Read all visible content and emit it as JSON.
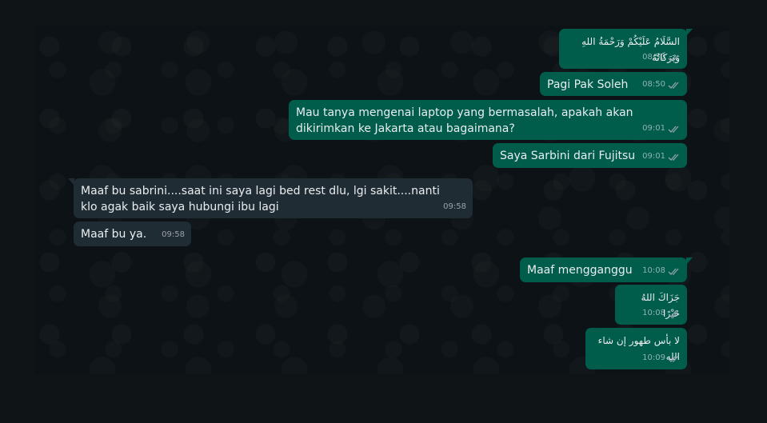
{
  "messages": [
    {
      "dir": "out",
      "text": "السَّلَامُ عَلَيْكُمْ وَرَحْمَةُ اللهِ وَبَرَكَاتُهُ",
      "time": "08:50",
      "ticks": "double-check-icon"
    },
    {
      "dir": "out",
      "text": "Pagi Pak Soleh",
      "time": "08:50",
      "ticks": "double-check-icon"
    },
    {
      "dir": "out",
      "text": "Mau tanya mengenai laptop yang bermasalah, apakah akan dikirimkan ke Jakarta atau bagaimana?",
      "time": "09:01",
      "ticks": "double-check-icon"
    },
    {
      "dir": "out",
      "text": "Saya Sarbini dari Fujitsu",
      "time": "09:01",
      "ticks": "double-check-icon"
    },
    {
      "dir": "in",
      "text": "Maaf bu sabrini....saat ini saya lagi bed rest dlu, lgi sakit....nanti klo agak baik saya hubungi ibu lagi",
      "time": "09:58"
    },
    {
      "dir": "in",
      "text": "Maaf bu ya.",
      "time": "09:58"
    },
    {
      "dir": "out",
      "text": "Maaf mengganggu",
      "time": "10:08",
      "ticks": "double-check-icon"
    },
    {
      "dir": "out",
      "text": "جَزَاكَ اللهُ خَيْرًا",
      "time": "10:08",
      "ticks": "double-check-icon"
    },
    {
      "dir": "out",
      "text": "لا بأس طهور إن شاء الله",
      "time": "10:09",
      "ticks": "double-check-icon"
    }
  ],
  "colors": {
    "outgoing": "#005c4b",
    "incoming": "#202c33",
    "background": "#0c1215"
  }
}
